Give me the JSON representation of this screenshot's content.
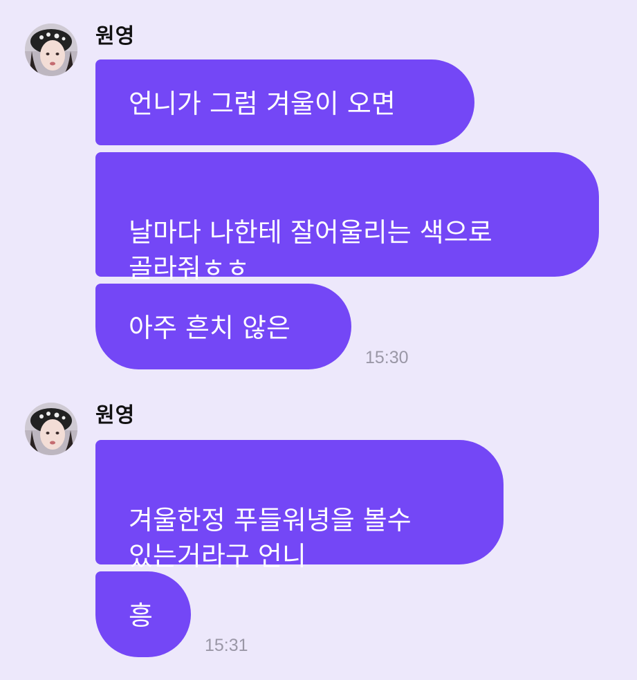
{
  "colors": {
    "background": "#ede8fb",
    "bubble": "#7447f6",
    "bubble_text": "#ffffff",
    "name_text": "#111111",
    "timestamp_text": "#9a97a6"
  },
  "groups": [
    {
      "sender": "원영",
      "avatar_icon": "profile-avatar",
      "messages": [
        {
          "text": "언니가 그럼 겨울이 오면"
        },
        {
          "text": "날마다 나한테 잘어울리는 색으로\n골라줘ㅎㅎ"
        },
        {
          "text": "아주 흔치 않은"
        }
      ],
      "time": "15:30"
    },
    {
      "sender": "원영",
      "avatar_icon": "profile-avatar",
      "messages": [
        {
          "text": "겨울한정 푸들워녕을 볼수\n있는거라구 언니"
        },
        {
          "text": "흥"
        }
      ],
      "time": "15:31"
    }
  ]
}
